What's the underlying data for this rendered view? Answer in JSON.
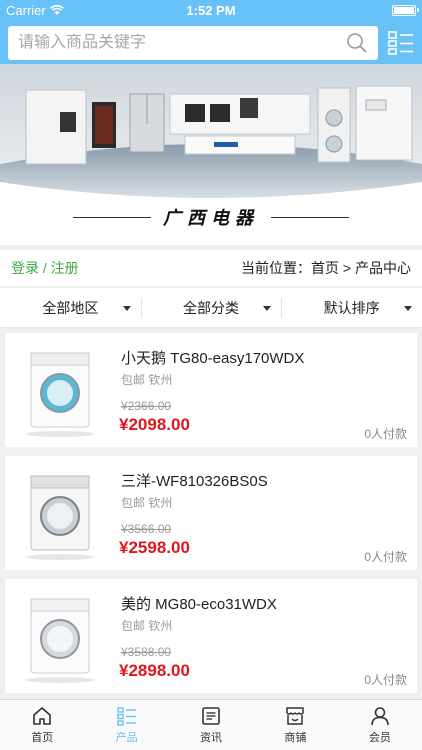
{
  "status": {
    "carrier": "Carrier",
    "time": "1:52 PM"
  },
  "search": {
    "placeholder": "请输入商品关键字"
  },
  "banner": {
    "title": "广西电器"
  },
  "breadcrumb": {
    "login": "登录",
    "separator": "/",
    "register": "注册",
    "location_label": "当前位置：",
    "home": "首页",
    "arrow": ">",
    "current": "产品中心"
  },
  "filters": [
    {
      "label": "全部地区"
    },
    {
      "label": "全部分类"
    },
    {
      "label": "默认排序"
    }
  ],
  "products": [
    {
      "name": "小天鹅 TG80-easy170WDX",
      "shipping": "包邮",
      "city": "钦州",
      "old_price": "¥2366.00",
      "price": "¥2098.00",
      "paid": "0人付款"
    },
    {
      "name": "三洋-WF810326BS0S",
      "shipping": "包邮",
      "city": "钦州",
      "old_price": "¥3566.00",
      "price": "¥2598.00",
      "paid": "0人付款"
    },
    {
      "name": "美的 MG80-eco31WDX",
      "shipping": "包邮",
      "city": "钦州",
      "old_price": "¥3588.00",
      "price": "¥2898.00",
      "paid": "0人付款"
    }
  ],
  "tabs": [
    {
      "label": "首页",
      "icon": "home-icon"
    },
    {
      "label": "产品",
      "icon": "list-icon",
      "active": true
    },
    {
      "label": "资讯",
      "icon": "news-icon"
    },
    {
      "label": "商铺",
      "icon": "store-icon"
    },
    {
      "label": "会员",
      "icon": "user-icon"
    }
  ],
  "colors": {
    "header": "#69c2f7",
    "price": "#e0151f",
    "login": "#3cab46"
  }
}
